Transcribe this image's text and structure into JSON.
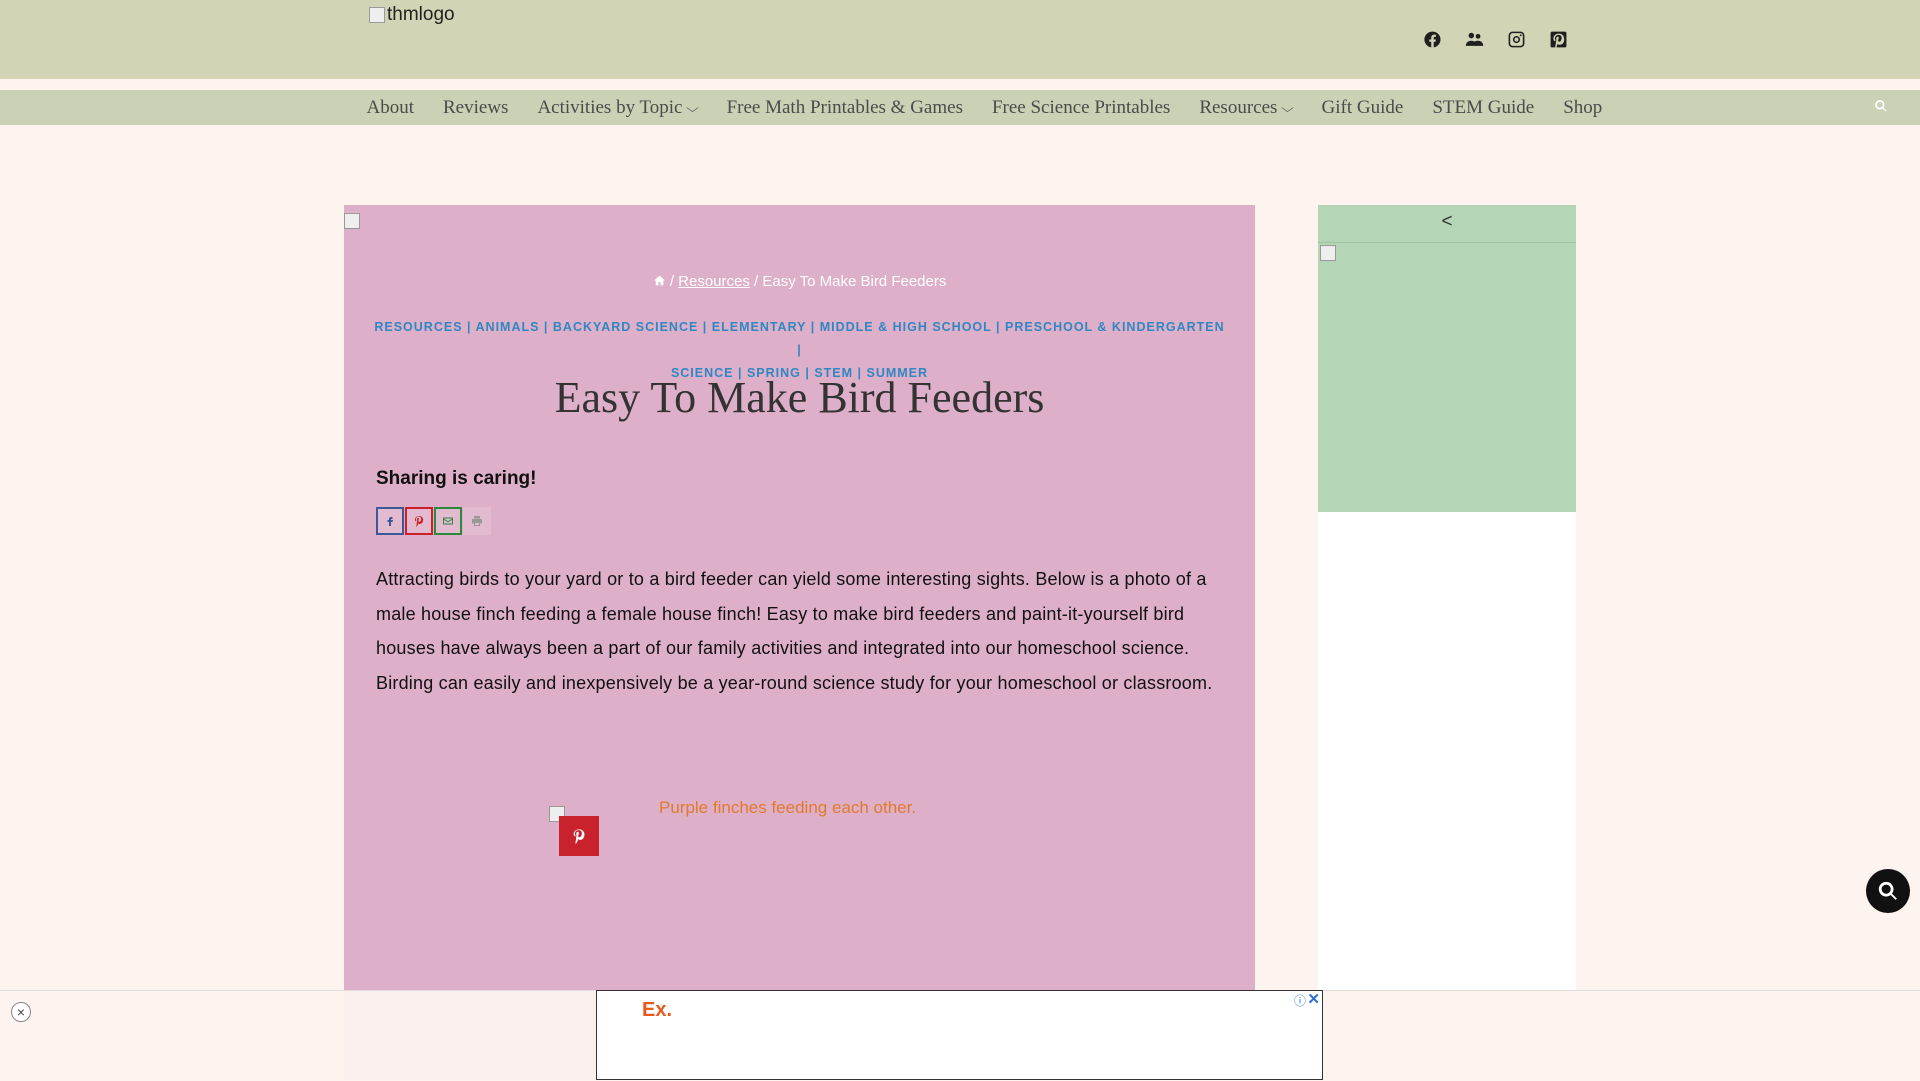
{
  "header": {
    "logo_alt": "thmlogo",
    "social_icons": [
      "facebook-icon",
      "facebook-group-icon",
      "instagram-icon",
      "pinterest-icon"
    ]
  },
  "nav": {
    "items": [
      {
        "label": "About"
      },
      {
        "label": "Reviews"
      },
      {
        "label": "Activities by Topic",
        "dropdown": true
      },
      {
        "label": "Free Math Printables & Games"
      },
      {
        "label": "Free Science Printables"
      },
      {
        "label": "Resources",
        "dropdown": true
      },
      {
        "label": "Gift Guide"
      },
      {
        "label": "STEM Guide"
      },
      {
        "label": "Shop"
      }
    ]
  },
  "breadcrumb": {
    "sep1": "/",
    "resources": "Resources",
    "sep2": "/",
    "current": "Easy To Make Bird Feeders"
  },
  "article": {
    "categories_line1": "RESOURCES | ANIMALS | BACKYARD SCIENCE | ELEMENTARY | MIDDLE & HIGH SCHOOL | PRESCHOOL & KINDERGARTEN |",
    "categories_line2": "SCIENCE | SPRING | STEM | SUMMER",
    "title": "Easy To Make Bird Feeders",
    "sharing_heading": "Sharing is caring!",
    "body": "Attracting birds to your yard or to a bird feeder can yield some interesting sights.  Below is a photo of a  male house finch feeding a female house finch! Easy to make bird feeders and paint-it-yourself bird houses have always been a part of our family activities and integrated into our homeschool science.  Birding can easily and inexpensively be a year-round science study for your homeschool or classroom.",
    "image_alt": "Purple finches feeding each other."
  },
  "sidebar": {
    "prev_arrow": "<"
  },
  "ad": {
    "logo": "Ex.",
    "close": "×",
    "info": "ⓘ",
    "x": "✕"
  },
  "colors": {
    "header_bg": "#d3d3b5",
    "nav_bg": "#c9d2b4",
    "page_bg": "#fdf4ef",
    "article_bg": "#deafc8",
    "sidebar_green": "#b5d6b6",
    "category_blue": "#2f87c3",
    "pinterest_red": "#c8232c"
  }
}
